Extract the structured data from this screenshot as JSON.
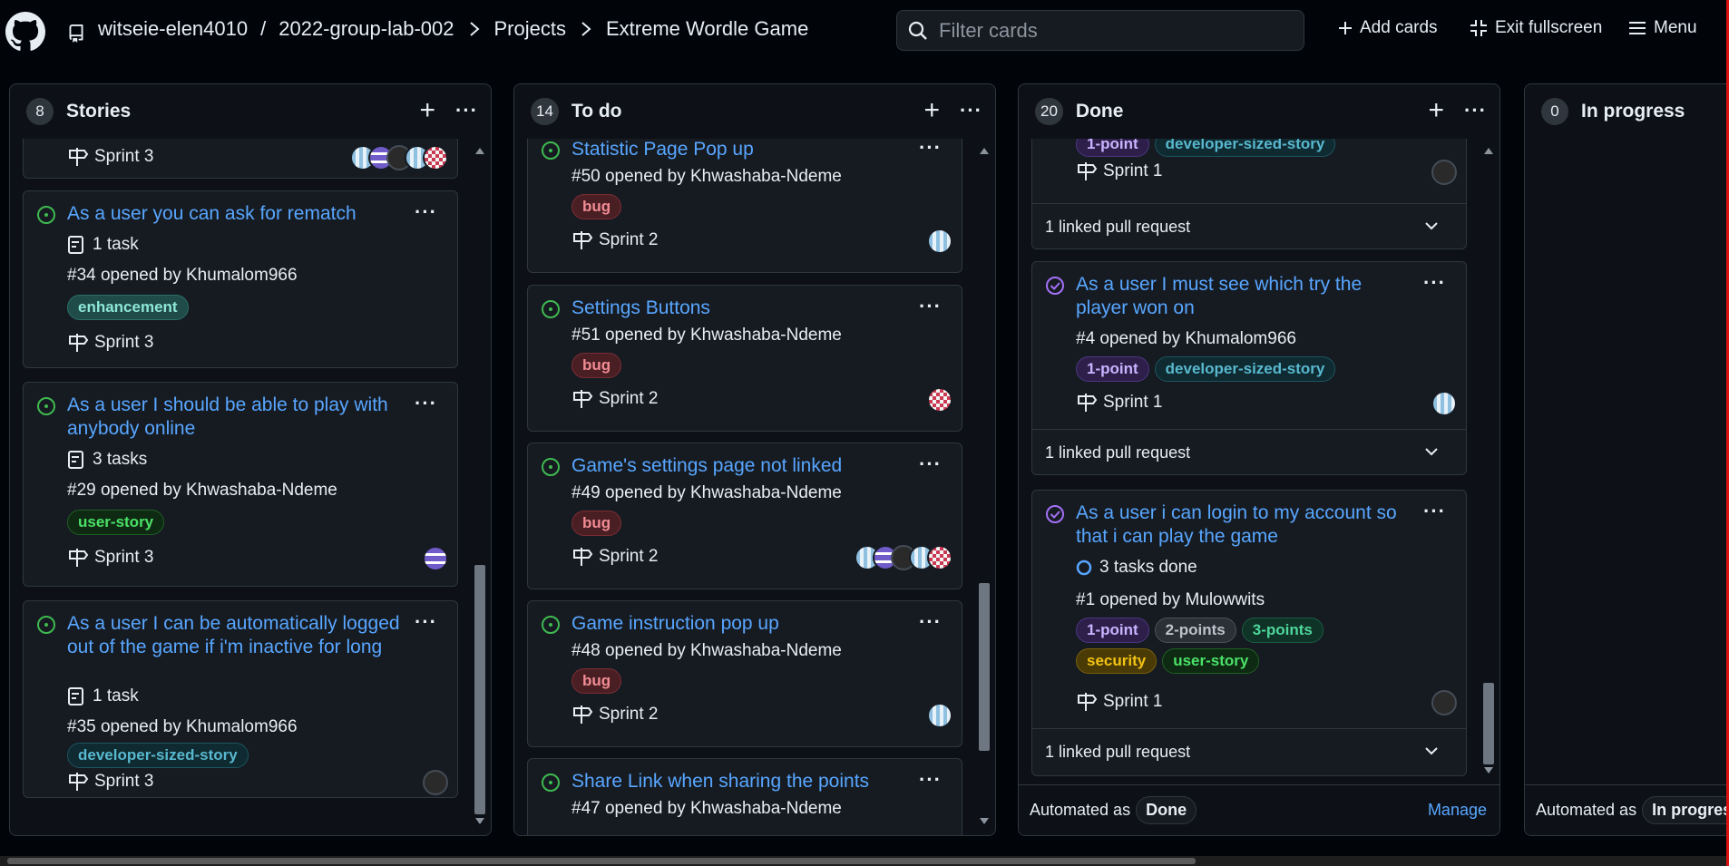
{
  "breadcrumb": {
    "owner": "witseie-elen4010",
    "repo": "2022-group-lab-002",
    "section": "Projects",
    "project": "Extreme Wordle Game"
  },
  "toolbar": {
    "filter_placeholder": "Filter cards",
    "add_cards": "Add cards",
    "exit_fullscreen": "Exit fullscreen",
    "menu": "Menu"
  },
  "columns": {
    "stories": {
      "count": "8",
      "title": "Stories",
      "partial_sprint": "Sprint 3",
      "cards": [
        {
          "title": "As a user you can ask for rematch",
          "tasks": "1 task",
          "opened": "#34 opened by Khumalom966",
          "label": "enhancement",
          "sprint": "Sprint 3"
        },
        {
          "title": "As a user I should be able to play with anybody online",
          "tasks": "3 tasks",
          "opened": "#29 opened by Khwashaba-Ndeme",
          "label": "user-story",
          "sprint": "Sprint 3"
        },
        {
          "title": "As a user I can be automatically logged out of the game if i'm inactive for long",
          "tasks": "1 task",
          "opened": "#35 opened by Khumalom966",
          "label": "developer-sized-story",
          "sprint": "Sprint 3"
        }
      ]
    },
    "todo": {
      "count": "14",
      "title": "To do",
      "cards": [
        {
          "title": "Statistic Page Pop up",
          "opened": "#50 opened by Khwashaba-Ndeme",
          "label": "bug",
          "sprint": "Sprint 2"
        },
        {
          "title": "Settings Buttons",
          "opened": "#51 opened by Khwashaba-Ndeme",
          "label": "bug",
          "sprint": "Sprint 2"
        },
        {
          "title": "Game's settings page not linked",
          "opened": "#49 opened by Khwashaba-Ndeme",
          "label": "bug",
          "sprint": "Sprint 2"
        },
        {
          "title": "Game instruction pop up",
          "opened": "#48 opened by Khwashaba-Ndeme",
          "label": "bug",
          "sprint": "Sprint 2"
        },
        {
          "title": "Share Link when sharing the points",
          "opened": "#47 opened by Khwashaba-Ndeme"
        }
      ]
    },
    "done": {
      "count": "20",
      "title": "Done",
      "partial": {
        "label1": "1-point",
        "label2": "developer-sized-story",
        "sprint": "Sprint 1",
        "pr": "1 linked pull request"
      },
      "cards": [
        {
          "title": "As a user I must see which try the player won on",
          "opened": "#4 opened by Khumalom966",
          "label1": "1-point",
          "label2": "developer-sized-story",
          "sprint": "Sprint 1",
          "pr": "1 linked pull request"
        },
        {
          "title": "As a user i can login to my account so that i can play the game",
          "tasks": "3 tasks done",
          "opened": "#1 opened by Mulowwits",
          "labels": [
            "1-point",
            "2-points",
            "3-points",
            "security",
            "user-story"
          ],
          "sprint": "Sprint 1",
          "pr": "1 linked pull request"
        }
      ],
      "footer": {
        "automated": "Automated as",
        "state": "Done",
        "manage": "Manage"
      }
    },
    "inprogress": {
      "count": "0",
      "title": "In progress",
      "footer": {
        "automated": "Automated as",
        "state": "In progres"
      }
    }
  }
}
